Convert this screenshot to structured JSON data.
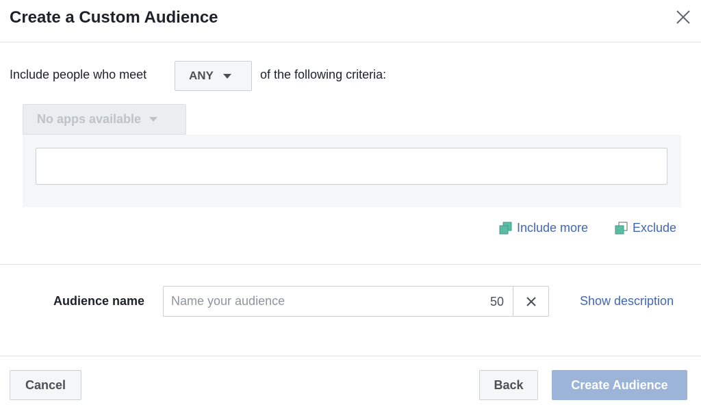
{
  "dialog": {
    "title": "Create a Custom Audience",
    "close_icon": "close-icon"
  },
  "criteria": {
    "prefix": "Include people who meet",
    "match_value": "ANY",
    "suffix": "of the following criteria:",
    "apps_dropdown_label": "No apps available",
    "input_value": ""
  },
  "actions": {
    "include_more": "Include more",
    "exclude": "Exclude",
    "include_more_icon": "include-more-icon",
    "exclude_icon": "exclude-icon"
  },
  "audience_name": {
    "label": "Audience name",
    "placeholder": "Name your audience",
    "value": "",
    "char_limit": "50",
    "show_description": "Show description"
  },
  "footer": {
    "cancel_label": "Cancel",
    "back_label": "Back",
    "create_label": "Create Audience"
  },
  "colors": {
    "link": "#4267b2",
    "primary_disabled": "#9cb4d8",
    "icon_teal": "#5bbca6"
  }
}
